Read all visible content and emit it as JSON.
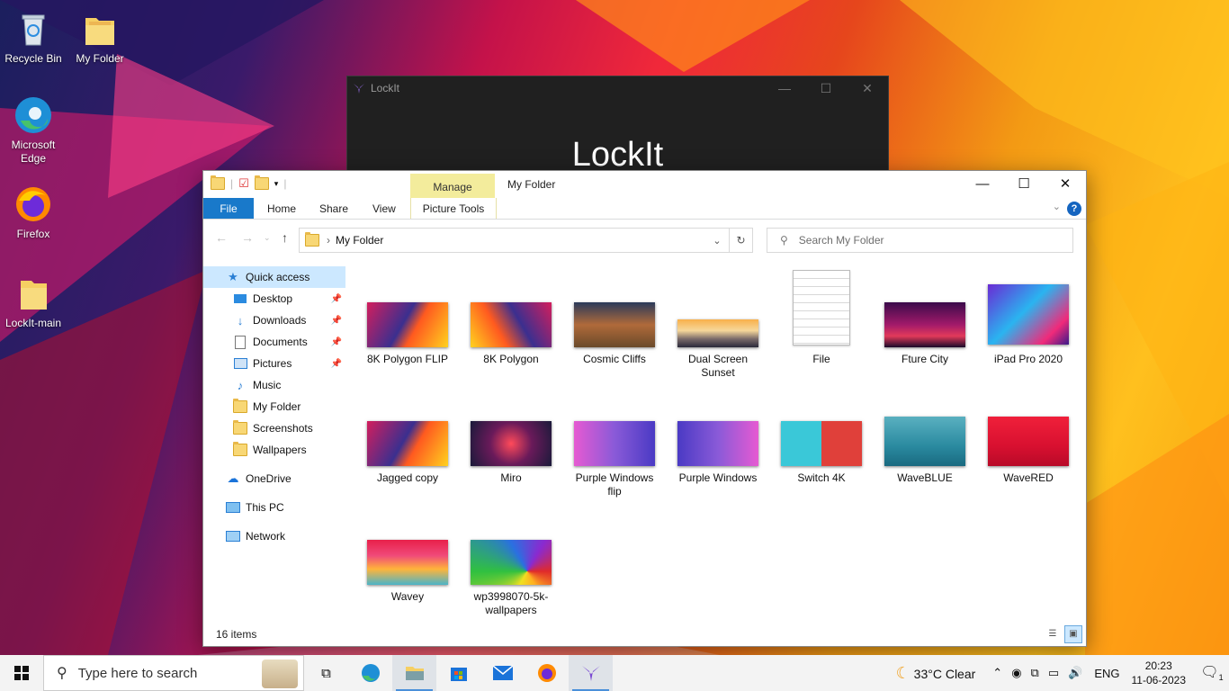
{
  "desktop": {
    "icons": [
      {
        "label": "Recycle Bin",
        "icon": "recycle-bin-icon"
      },
      {
        "label": "My Folder",
        "icon": "folder-icon"
      },
      {
        "label": "Microsoft Edge",
        "icon": "edge-icon"
      },
      {
        "label": "Firefox",
        "icon": "firefox-icon"
      },
      {
        "label": "LockIt-main",
        "icon": "folder-icon"
      }
    ]
  },
  "lockit_window": {
    "title": "LockIt",
    "heading": "LockIt",
    "controls": [
      "—",
      "☐",
      "✕"
    ]
  },
  "explorer": {
    "title": "My Folder",
    "manage_tab": "Manage",
    "ribbon_tabs": {
      "file": "File",
      "home": "Home",
      "share": "Share",
      "view": "View",
      "picture_tools": "Picture Tools"
    },
    "help": "?",
    "address": {
      "path": "My Folder",
      "separator": "›"
    },
    "search_placeholder": "Search My Folder",
    "nav": {
      "quick_access": "Quick access",
      "desktop": "Desktop",
      "downloads": "Downloads",
      "documents": "Documents",
      "pictures": "Pictures",
      "music": "Music",
      "my_folder": "My Folder",
      "screenshots": "Screenshots",
      "wallpapers": "Wallpapers",
      "onedrive": "OneDrive",
      "this_pc": "This PC",
      "network": "Network"
    },
    "files": [
      {
        "name": "8K Polygon FLIP"
      },
      {
        "name": "8K Polygon"
      },
      {
        "name": "Cosmic Cliffs"
      },
      {
        "name": "Dual Screen Sunset"
      },
      {
        "name": "File"
      },
      {
        "name": "Fture City"
      },
      {
        "name": "iPad Pro 2020"
      },
      {
        "name": "Jagged copy"
      },
      {
        "name": "Miro"
      },
      {
        "name": "Purple Windows flip"
      },
      {
        "name": "Purple Windows"
      },
      {
        "name": "Switch 4K"
      },
      {
        "name": "WaveBLUE"
      },
      {
        "name": "WaveRED"
      },
      {
        "name": "Wavey"
      },
      {
        "name": "wp3998070-5k-wallpapers"
      }
    ],
    "status": "16 items"
  },
  "taskbar": {
    "search_placeholder": "Type here to search",
    "weather": "33°C  Clear",
    "lang": "ENG",
    "time": "20:23",
    "date": "11-06-2023",
    "notif_count": "1"
  },
  "colors": {
    "accent": "#1979ca",
    "manage": "#f3ec9c",
    "selection": "#cce8ff"
  }
}
